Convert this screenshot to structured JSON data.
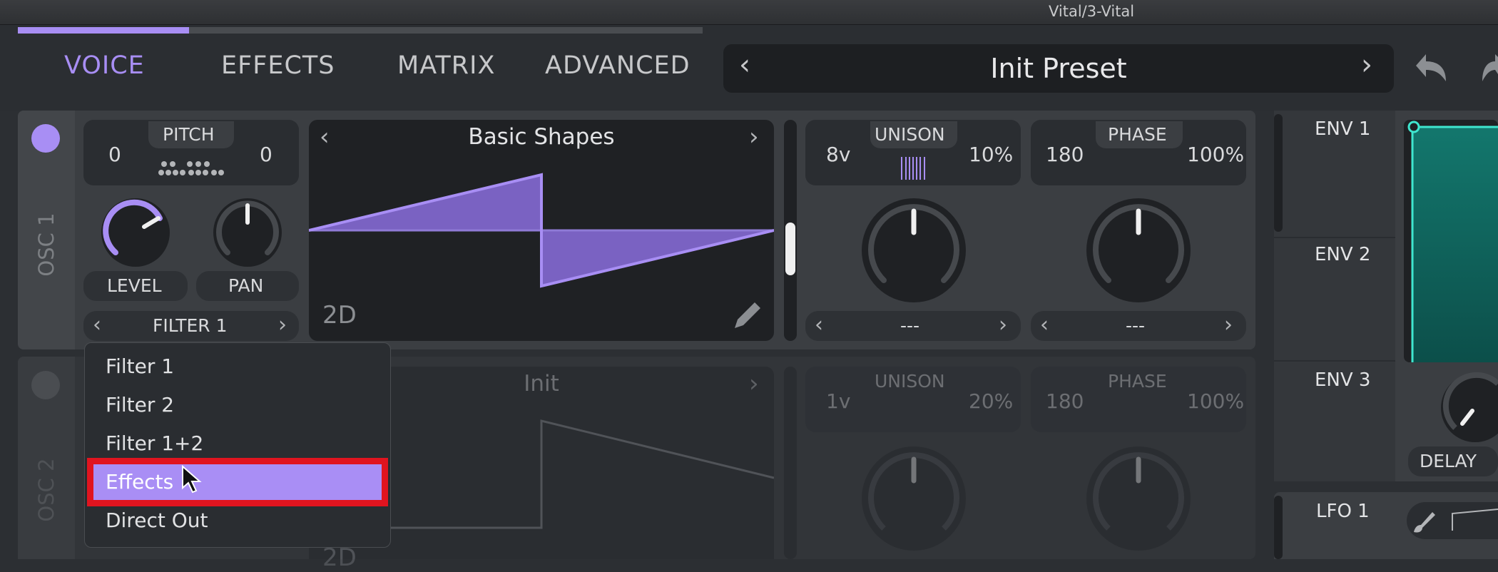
{
  "window": {
    "title": "Vital/3-Vital"
  },
  "tabs": [
    "VOICE",
    "EFFECTS",
    "MATRIX",
    "ADVANCED"
  ],
  "preset": {
    "name": "Init Preset"
  },
  "progress": {
    "fraction": 0.25
  },
  "osc1": {
    "side_label": "OSC 1",
    "pitch_label": "PITCH",
    "pitch_left": "0",
    "pitch_right": "0",
    "level_label": "LEVEL",
    "pan_label": "PAN",
    "route": "FILTER 1",
    "wavetable_name": "Basic Shapes",
    "mode": "2D",
    "unison_label": "UNISON",
    "unison_voices": "8v",
    "unison_detune": "10%",
    "phase_label": "PHASE",
    "phase_value": "180",
    "phase_random": "100%",
    "unison_select": "---",
    "phase_select": "---"
  },
  "osc2": {
    "side_label": "OSC 2",
    "wavetable_name": "Init",
    "mode": "2D",
    "unison_label": "UNISON",
    "unison_voices": "1v",
    "unison_detune": "20%",
    "phase_label": "PHASE",
    "phase_value": "180",
    "phase_random": "100%"
  },
  "dropdown": {
    "items": [
      "Filter 1",
      "Filter 2",
      "Filter 1+2",
      "Effects",
      "Direct Out"
    ],
    "selected_index": 3
  },
  "modulators": {
    "env1": "ENV 1",
    "env2": "ENV 2",
    "env3": "ENV 3",
    "lfo1": "LFO 1",
    "delay_label": "DELAY"
  },
  "colors": {
    "accent": "#a88ef4",
    "highlight": "#e0141f",
    "env_fill": "#0f6e66",
    "env_line": "#3fe6cf"
  }
}
